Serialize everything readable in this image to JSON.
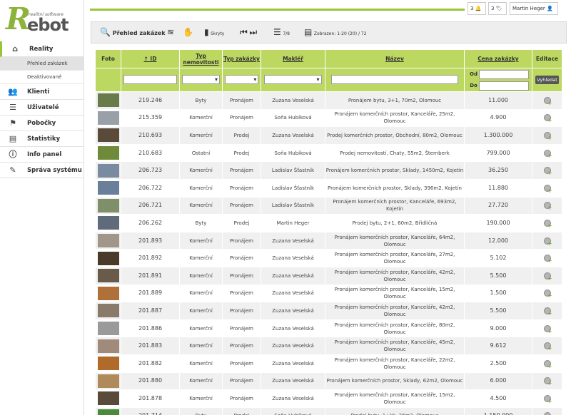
{
  "brand": {
    "letter": "R",
    "name": "ebot",
    "tagline": "realitní software"
  },
  "sidebar": {
    "items": [
      {
        "label": "Reality",
        "icon": "home-icon",
        "glyph": "⌂"
      },
      {
        "label": "Klienti",
        "icon": "users-icon",
        "glyph": "👥"
      },
      {
        "label": "Uživatelé",
        "icon": "user-list-icon",
        "glyph": "☰"
      },
      {
        "label": "Pobočky",
        "icon": "palm-icon",
        "glyph": "⚑"
      },
      {
        "label": "Statistiky",
        "icon": "chart-icon",
        "glyph": "▤"
      },
      {
        "label": "Info panel",
        "icon": "info-icon",
        "glyph": "ⓘ"
      },
      {
        "label": "Správa systému",
        "icon": "settings-icon",
        "glyph": "✎"
      }
    ],
    "sub_items": [
      "Přehled zakázek",
      "Deaktivované"
    ]
  },
  "topbar": {
    "notif_count": "3",
    "tags_count": "3",
    "user_name": "Martin Heger"
  },
  "toolbar": {
    "title": "Přehled zakázek",
    "hidden_label": "Skryty",
    "page_indicator": "7/8",
    "showing": "Zobrazen: 1-20 (20) / 72"
  },
  "table": {
    "headers": {
      "foto": "Foto",
      "id": "↑ ID",
      "typ_nemovitosti": "Typ nemovitosti",
      "typ_zakazky": "Typ zakázky",
      "makler": "Makléř",
      "nazev": "Název",
      "cena": "Cena zakázky",
      "editace": "Editace"
    },
    "filter": {
      "od": "Od",
      "do": "Do",
      "search_button": "Vyhledat"
    },
    "rows": [
      {
        "id": "219.246",
        "typ": "Byty",
        "zakazka": "Pronájem",
        "makler": "Zuzana Veselská",
        "nazev": "Pronájem bytu, 3+1, 70m2, Olomouc",
        "cena": "11.000",
        "photo": "#6b7a4a"
      },
      {
        "id": "215.359",
        "typ": "Komerční",
        "zakazka": "Pronájem",
        "makler": "Soňa Hubíková",
        "nazev": "Pronájem komerčních prostor, Kanceláře, 25m2, Olomouc",
        "cena": "4.900",
        "photo": "#9aa0a8"
      },
      {
        "id": "210.693",
        "typ": "Komerční",
        "zakazka": "Prodej",
        "makler": "Zuzana Veselská",
        "nazev": "Prodej komerčních prostor, Obchodní, 80m2, Olomouc",
        "cena": "1.300.000",
        "photo": "#5a4a3a"
      },
      {
        "id": "210.683",
        "typ": "Ostatní",
        "zakazka": "Prodej",
        "makler": "Soňa Hubíková",
        "nazev": "Prodej nemovitostí, Chaty, 55m2, Šternberk",
        "cena": "799.000",
        "photo": "#6f8a3a"
      },
      {
        "id": "206.723",
        "typ": "Komerční",
        "zakazka": "Pronájem",
        "makler": "Ladislav Šťastník",
        "nazev": "Pronájem komerčních prostor, Sklady, 1450m2, Kojetín",
        "cena": "36.250",
        "photo": "#7a8aa0"
      },
      {
        "id": "206.722",
        "typ": "Komerční",
        "zakazka": "Pronájem",
        "makler": "Ladislav Šťastník",
        "nazev": "Pronájem komerčních prostor, Sklady, 396m2, Kojetín",
        "cena": "11.880",
        "photo": "#6a7f9a"
      },
      {
        "id": "206.721",
        "typ": "Komerční",
        "zakazka": "Pronájem",
        "makler": "Ladislav Šťastník",
        "nazev": "Pronájem komerčních prostor, Kanceláře, 693m2, Kojetín",
        "cena": "27.720",
        "photo": "#7f8f6a"
      },
      {
        "id": "206.262",
        "typ": "Byty",
        "zakazka": "Prodej",
        "makler": "Martin Heger",
        "nazev": "Prodej bytu, 2+1, 60m2, Břidličná",
        "cena": "190.000",
        "photo": "#5f6a7a"
      },
      {
        "id": "201.893",
        "typ": "Komerční",
        "zakazka": "Pronájem",
        "makler": "Zuzana Veselská",
        "nazev": "Pronájem komerčních prostor, Kanceláře, 64m2, Olomouc",
        "cena": "12.000",
        "photo": "#a0968a"
      },
      {
        "id": "201.892",
        "typ": "Komerční",
        "zakazka": "Pronájem",
        "makler": "Zuzana Veselská",
        "nazev": "Pronájem komerčních prostor, Kanceláře, 27m2, Olomouc",
        "cena": "5.102",
        "photo": "#4a3a2a"
      },
      {
        "id": "201.891",
        "typ": "Komerční",
        "zakazka": "Pronájem",
        "makler": "Zuzana Veselská",
        "nazev": "Pronájem komerčních prostor, Kanceláře, 42m2, Olomouc",
        "cena": "5.500",
        "photo": "#6a5a4a"
      },
      {
        "id": "201.889",
        "typ": "Komerční",
        "zakazka": "Pronájem",
        "makler": "Zuzana Veselská",
        "nazev": "Pronájem komerčních prostor, Kanceláře, 15m2, Olomouc",
        "cena": "1.500",
        "photo": "#b0703a"
      },
      {
        "id": "201.887",
        "typ": "Komerční",
        "zakazka": "Pronájem",
        "makler": "Zuzana Veselská",
        "nazev": "Pronájem komerčních prostor, Kanceláře, 42m2, Olomouc",
        "cena": "5.500",
        "photo": "#8a7a6a"
      },
      {
        "id": "201.886",
        "typ": "Komerční",
        "zakazka": "Pronájem",
        "makler": "Zuzana Veselská",
        "nazev": "Pronájem komerčních prostor, Kanceláře, 80m2, Olomouc",
        "cena": "9.000",
        "photo": "#9a9a9a"
      },
      {
        "id": "201.883",
        "typ": "Komerční",
        "zakazka": "Pronájem",
        "makler": "Zuzana Veselská",
        "nazev": "Pronájem komerčních prostor, Kanceláře, 45m2, Olomouc",
        "cena": "9.612",
        "photo": "#a08a7a"
      },
      {
        "id": "201.882",
        "typ": "Komerční",
        "zakazka": "Pronájem",
        "makler": "Zuzana Veselská",
        "nazev": "Pronájem komerčních prostor, Kanceláře, 22m2, Olomouc",
        "cena": "2.500",
        "photo": "#b06a2a"
      },
      {
        "id": "201.880",
        "typ": "Komerční",
        "zakazka": "Pronájem",
        "makler": "Zuzana Veselská",
        "nazev": "Pronájem komerčních prostor, Sklady, 62m2, Olomouc",
        "cena": "6.000",
        "photo": "#b08a5a"
      },
      {
        "id": "201.878",
        "typ": "Komerční",
        "zakazka": "Pronájem",
        "makler": "Zuzana Veselská",
        "nazev": "Pronájem komerčních prostor, Kanceláře, 15m2, Olomouc",
        "cena": "4.500",
        "photo": "#5a4a3a"
      },
      {
        "id": "201.714",
        "typ": "Byty",
        "zakazka": "Prodej",
        "makler": "Soňa Hubíková",
        "nazev": "Prodej bytu, 1+kk, 26m2, Olomouc",
        "cena": "1.150.000",
        "photo": "#4a8a3a"
      }
    ]
  },
  "colors": {
    "accent": "#9bc43a",
    "header_bg": "#bcd860"
  }
}
